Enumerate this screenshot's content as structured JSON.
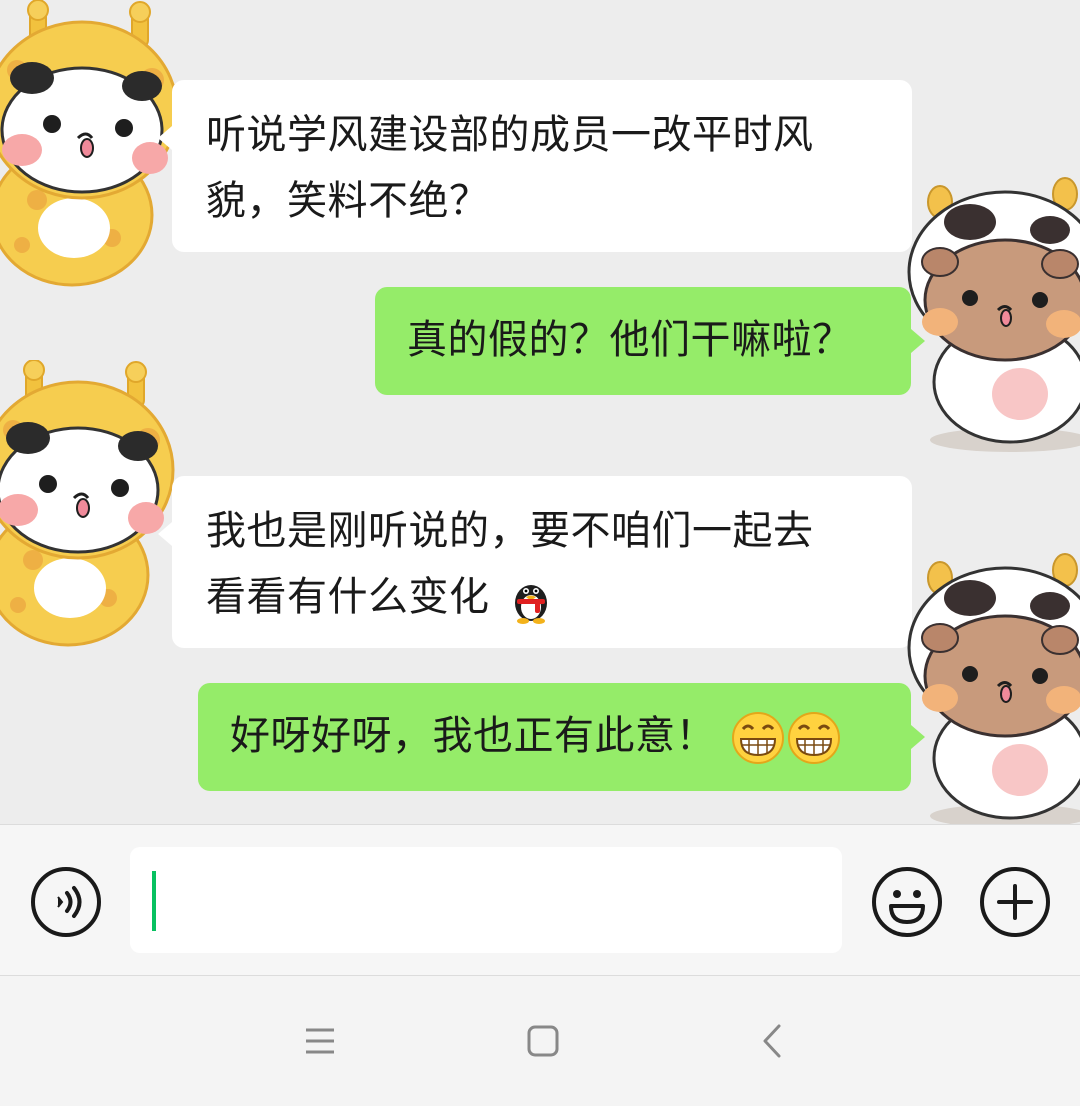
{
  "messages": [
    {
      "side": "in",
      "text_line1": "听说学风建设部的成员一改平时风",
      "text_line2": "貌，笑料不绝？"
    },
    {
      "side": "out",
      "text": "真的假的？他们干嘛啦？"
    },
    {
      "side": "in",
      "text_line1": "我也是刚听说的，要不咱们一起去",
      "text_line2": "看看有什么变化",
      "emoji": "penguin-emoji"
    },
    {
      "side": "out",
      "text": "好呀好呀，我也正有此意！",
      "emojis": [
        "grin-emoji",
        "grin-emoji"
      ]
    }
  ],
  "input_bar": {
    "value": "",
    "icons": {
      "voice": "voice-icon",
      "emoji": "smiley-icon",
      "more": "plus-icon"
    }
  },
  "nav_bar": {
    "icons": [
      "menu-icon",
      "home-icon",
      "back-icon"
    ]
  },
  "colors": {
    "chat_bg": "#ededed",
    "incoming_bubble": "#ffffff",
    "outgoing_bubble": "#95ec69",
    "caret": "#07c160",
    "giraffe_yellow": "#f5c842",
    "cow_brown": "#c89a7c"
  }
}
